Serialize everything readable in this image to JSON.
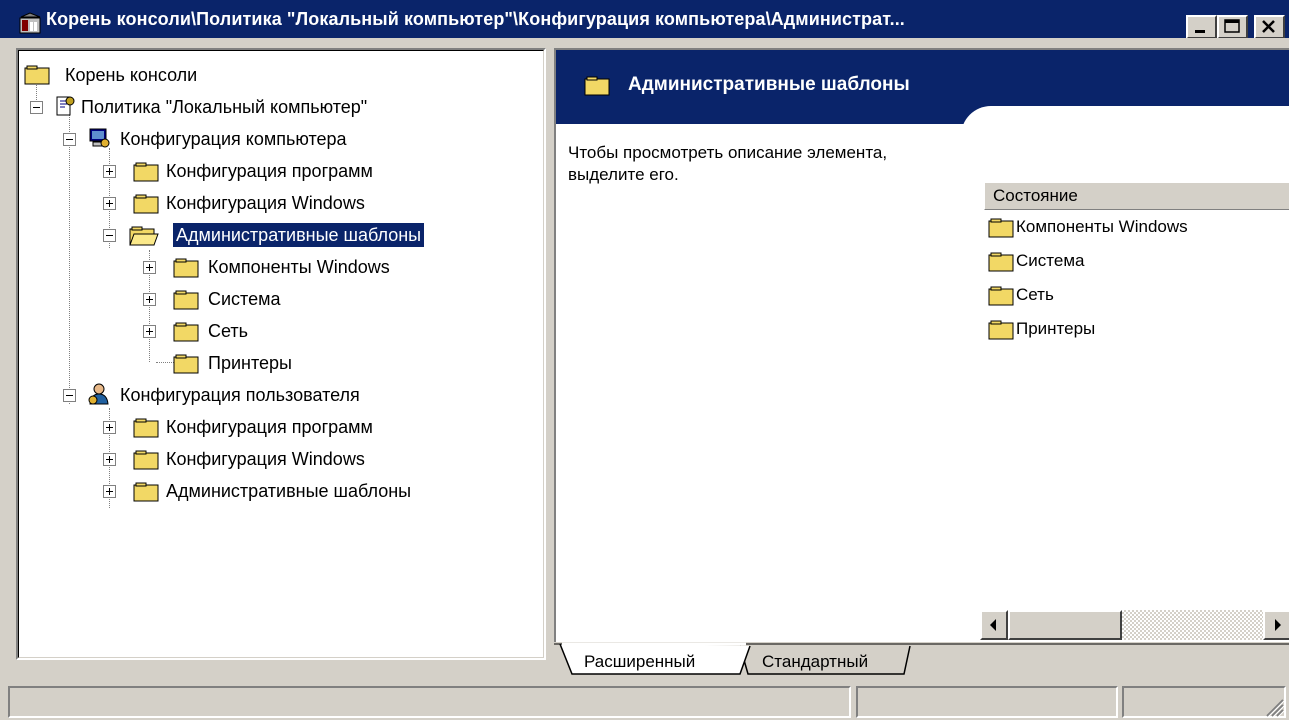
{
  "window": {
    "title": "Корень консоли\\Политика \"Локальный компьютер\"\\Конфигурация компьютера\\Администрат...",
    "controls": {
      "minimize": "minimize-icon",
      "maximize": "maximize-icon",
      "close": "close-icon"
    }
  },
  "tree": {
    "root": "Корень консоли",
    "policy": "Политика \"Локальный компьютер\"",
    "computer_config": "Конфигурация компьютера",
    "cc_software": "Конфигурация программ",
    "cc_windows": "Конфигурация Windows",
    "cc_admin": "Административные шаблоны",
    "cc_admin_components": "Компоненты Windows",
    "cc_admin_system": "Система",
    "cc_admin_network": "Сеть",
    "cc_admin_printers": "Принтеры",
    "user_config": "Конфигурация пользователя",
    "uc_software": "Конфигурация программ",
    "uc_windows": "Конфигурация Windows",
    "uc_admin": "Административные шаблоны"
  },
  "details": {
    "header_title": "Административные шаблоны",
    "description": "Чтобы просмотреть описание элемента, выделите его.",
    "column_header": "Состояние",
    "items": [
      "Компоненты Windows",
      "Система",
      "Сеть",
      "Принтеры"
    ]
  },
  "tabs": {
    "extended": "Расширенный",
    "standard": "Стандартный"
  },
  "colors": {
    "titlebar": "#0a246a",
    "face": "#d4d0c8",
    "selection": "#0a246a",
    "folder": "#f2d865"
  }
}
